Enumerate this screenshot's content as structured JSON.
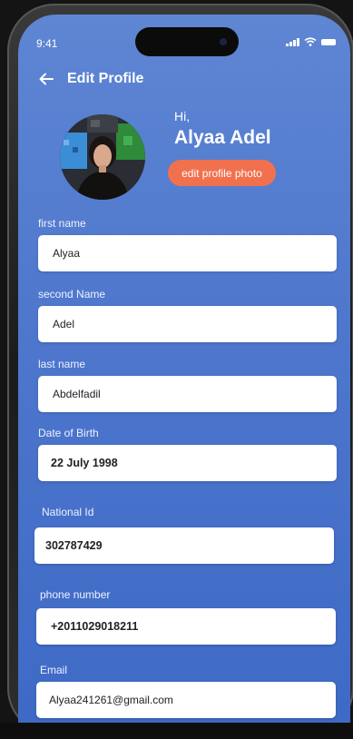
{
  "status_bar": {
    "time": "9:41"
  },
  "header": {
    "title": "Edit Profile"
  },
  "profile": {
    "greeting": "Hi,",
    "name": "Alyaa Adel",
    "edit_photo_label": "edit profile photo"
  },
  "form": {
    "first_name": {
      "label": "first name",
      "value": "Alyaa"
    },
    "second_name": {
      "label": "second Name",
      "value": "Adel"
    },
    "last_name": {
      "label": "last name",
      "value": "Abdelfadil"
    },
    "date_of_birth": {
      "label": "Date of Birth",
      "value": "22 July 1998"
    },
    "national_id": {
      "label": "National Id",
      "value": "302787429"
    },
    "phone_number": {
      "label": "phone number",
      "value": "+2011029018211"
    },
    "email": {
      "label": "Email",
      "value": "Alyaa241261@gmail.com"
    }
  },
  "colors": {
    "background_top": "#5f86d3",
    "background_bottom": "#3d69c6",
    "accent_button": "#f1714f",
    "field_background": "#ffffff"
  },
  "icons": {
    "back": "arrow-left-icon",
    "signal": "signal-icon",
    "wifi": "wifi-icon",
    "battery": "battery-icon"
  }
}
